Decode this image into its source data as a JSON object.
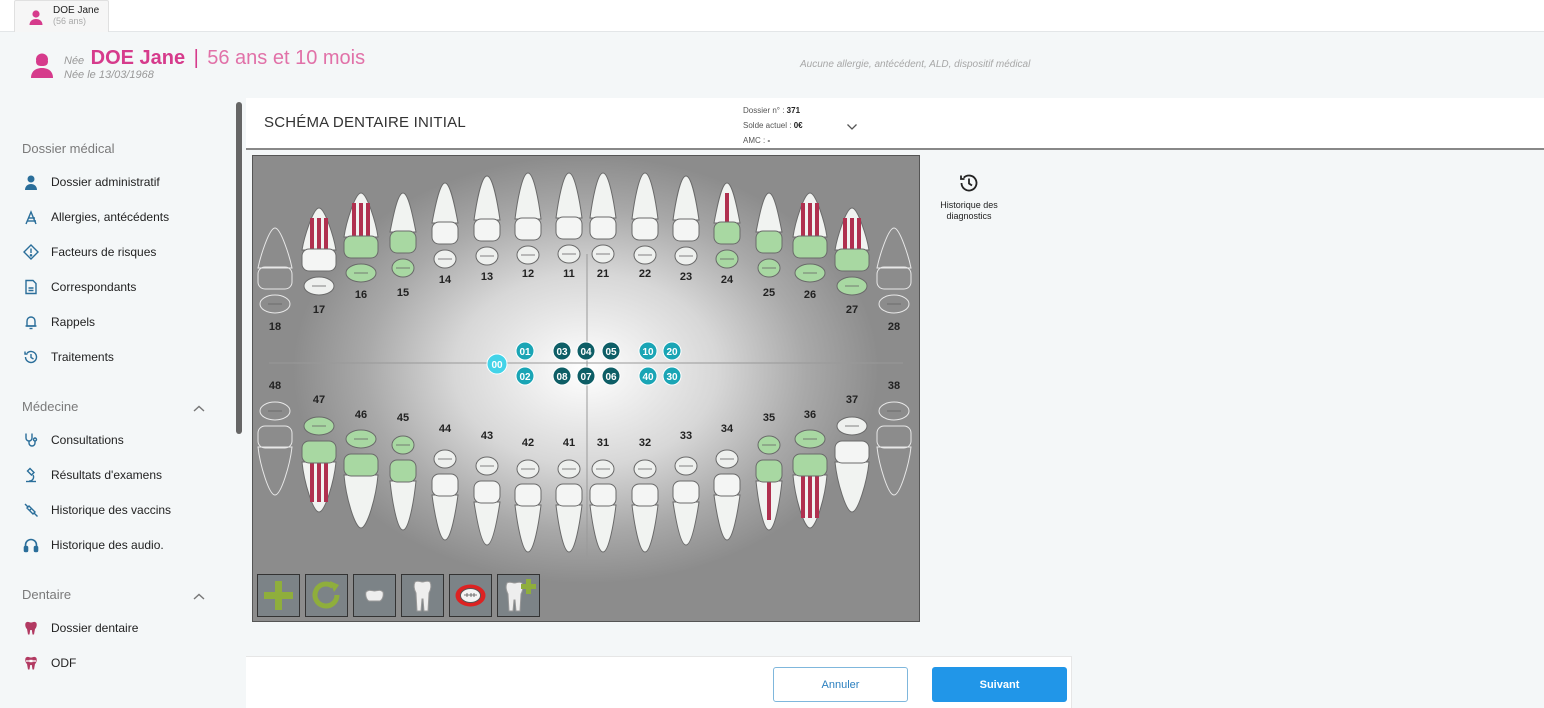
{
  "tab": {
    "name": "DOE Jane",
    "age": "(56 ans)"
  },
  "patient": {
    "nee_prefix": "Née",
    "name": "DOE Jane",
    "separator": "|",
    "age": "56 ans et 10 mois",
    "dob": "Née le 13/03/1968",
    "alerts": "Aucune allergie, antécédent, ALD, dispositif médical"
  },
  "sidebar": {
    "sections": [
      {
        "title": "Dossier médical",
        "items": [
          {
            "label": "Dossier administratif",
            "icon": "user-badge-icon"
          },
          {
            "label": "Allergies, antécédents",
            "icon": "allergy-icon"
          },
          {
            "label": "Facteurs de risques",
            "icon": "warning-diamond-icon"
          },
          {
            "label": "Correspondants",
            "icon": "contact-card-icon"
          },
          {
            "label": "Rappels",
            "icon": "bell-icon"
          },
          {
            "label": "Traitements",
            "icon": "history-clock-icon"
          }
        ]
      },
      {
        "title": "Médecine",
        "items": [
          {
            "label": "Consultations",
            "icon": "stethoscope-icon"
          },
          {
            "label": "Résultats d'examens",
            "icon": "microscope-icon"
          },
          {
            "label": "Historique des vaccins",
            "icon": "syringe-icon"
          },
          {
            "label": "Historique des audio.",
            "icon": "headphones-icon"
          }
        ]
      },
      {
        "title": "Dentaire",
        "items": [
          {
            "label": "Dossier dentaire",
            "icon": "tooth-icon"
          },
          {
            "label": "ODF",
            "icon": "tooth-braces-icon"
          }
        ]
      }
    ]
  },
  "main": {
    "title": "SCHÉMA DENTAIRE INITIAL",
    "dossier": {
      "label": "Dossier n° :",
      "value": "371"
    },
    "solde": {
      "label": "Solde actuel :",
      "value": "0€"
    },
    "amc": {
      "label": "AMC :",
      "value": "-"
    }
  },
  "history_button": "Historique des diagnostics",
  "dental_chart": {
    "upper_teeth": [
      "18",
      "17",
      "16",
      "15",
      "14",
      "13",
      "12",
      "11",
      "21",
      "22",
      "23",
      "24",
      "25",
      "26",
      "27",
      "28"
    ],
    "lower_teeth": [
      "48",
      "47",
      "46",
      "45",
      "44",
      "43",
      "42",
      "41",
      "31",
      "32",
      "33",
      "34",
      "35",
      "36",
      "37",
      "38"
    ],
    "treated_teeth": [
      "17",
      "16",
      "26",
      "27",
      "24",
      "47",
      "36",
      "35"
    ],
    "highlighted_crowns": [
      "16",
      "15",
      "24",
      "25",
      "26",
      "27",
      "47",
      "46",
      "45",
      "35",
      "36"
    ],
    "quadrant_markers": {
      "center": "00",
      "top": [
        "01",
        "03",
        "04",
        "05",
        "10",
        "20"
      ],
      "bottom": [
        "02",
        "08",
        "07",
        "06",
        "40",
        "30"
      ]
    }
  },
  "tools": [
    "add-icon",
    "refresh-icon",
    "tooth-crown-icon",
    "tooth-root-icon",
    "occlusal-view-icon",
    "tooth-add-icon"
  ],
  "footer": {
    "cancel": "Annuler",
    "next": "Suivant"
  }
}
